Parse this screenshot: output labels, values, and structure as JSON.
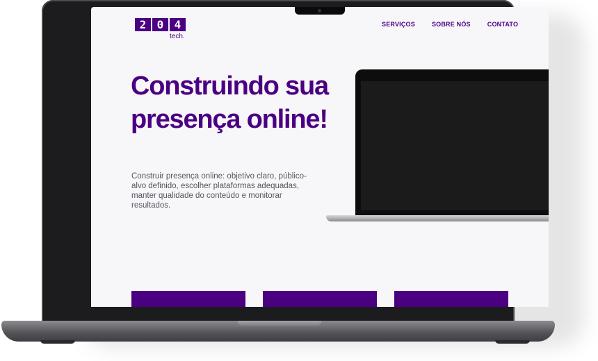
{
  "site": {
    "logo": {
      "digits": [
        "2",
        "0",
        "4"
      ],
      "subtitle": "tech."
    },
    "nav": {
      "items": [
        {
          "label": "SERVIÇOS"
        },
        {
          "label": "SOBRE NÓS"
        },
        {
          "label": "CONTATO"
        }
      ]
    },
    "hero": {
      "title": "Construindo sua presença online!",
      "description": "Construir presença online: objetivo claro, público-alvo definido, escolher plataformas adequadas, manter qualidade do conteúdo e monitorar resultados."
    }
  },
  "colors": {
    "brand": "#4b0082",
    "page_background": "#f7f6f8",
    "text_muted": "#555560"
  },
  "icons": [
    "laptop-illustration"
  ]
}
